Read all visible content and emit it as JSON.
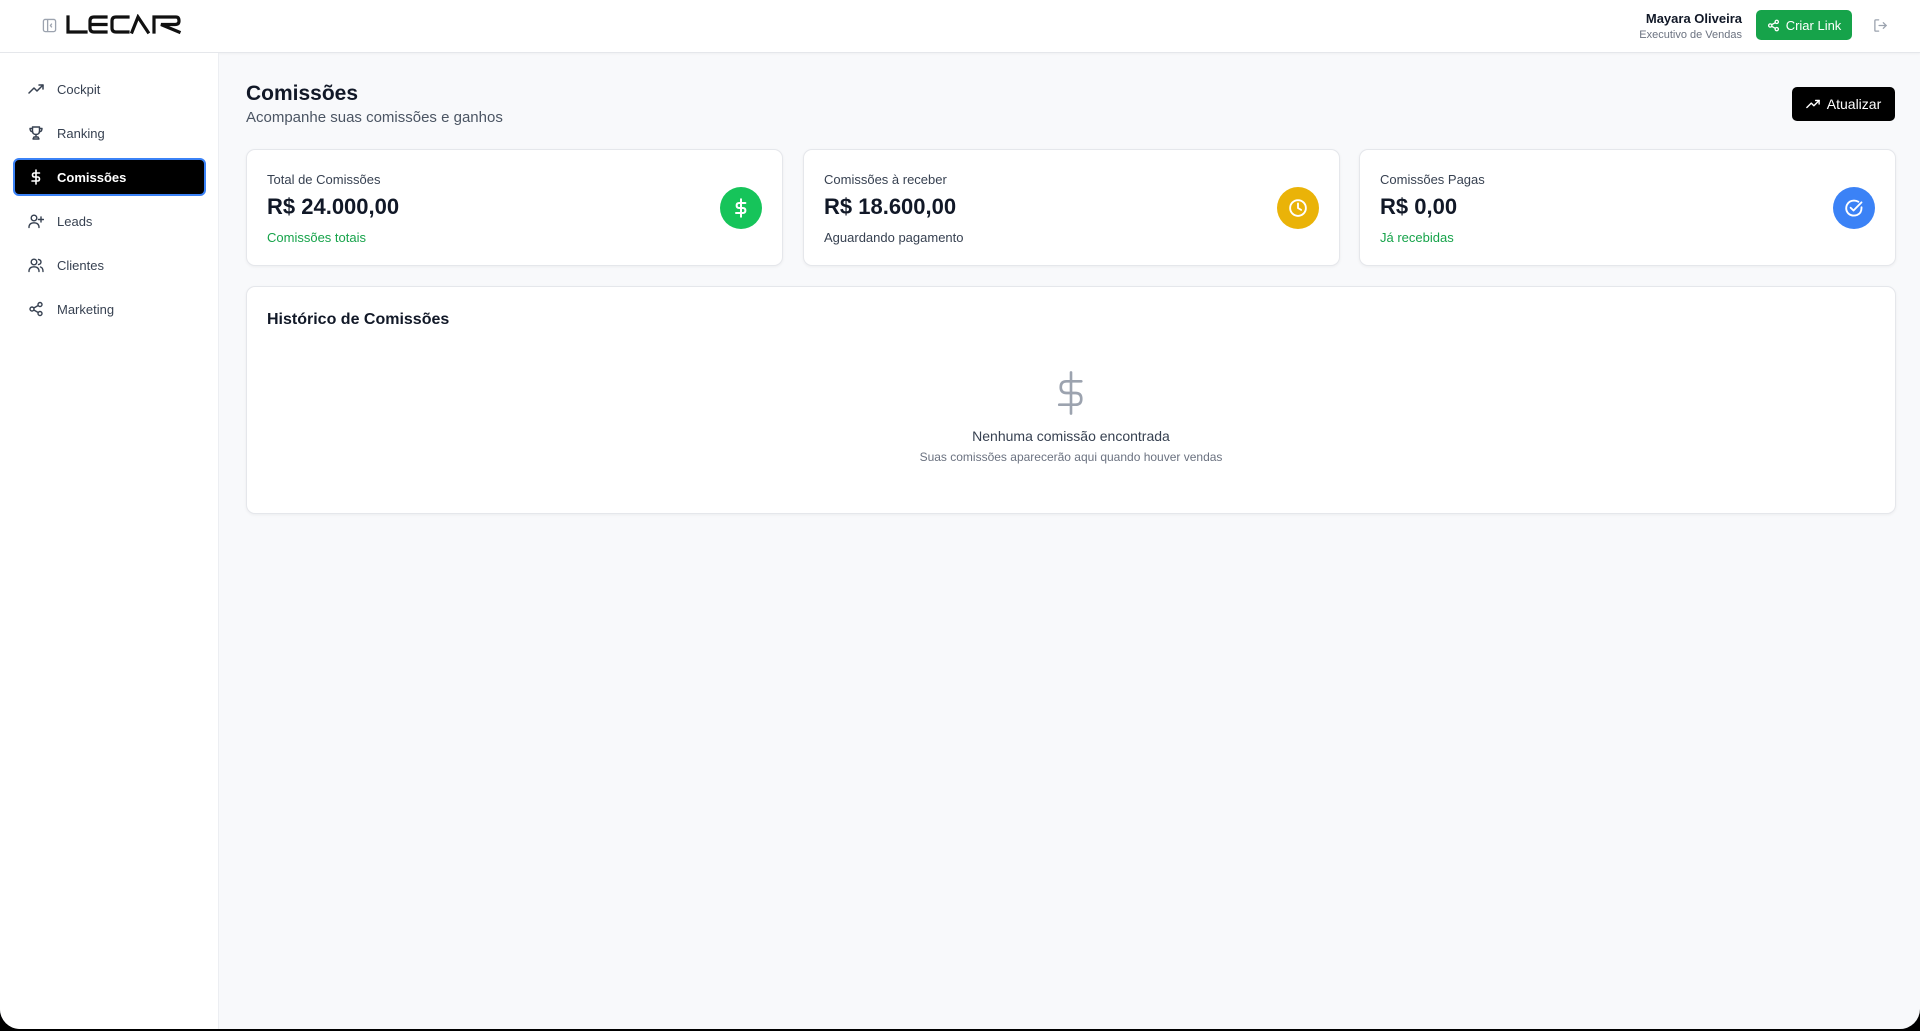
{
  "app": {
    "logo_text": "LECAR"
  },
  "header": {
    "user_name": "Mayara Oliveira",
    "user_role": "Executivo de Vendas",
    "create_link_label": "Criar Link"
  },
  "sidebar": {
    "items": [
      {
        "label": "Cockpit",
        "icon": "trending-up-icon",
        "active": false
      },
      {
        "label": "Ranking",
        "icon": "trophy-icon",
        "active": false
      },
      {
        "label": "Comissões",
        "icon": "dollar-sign-icon",
        "active": true
      },
      {
        "label": "Leads",
        "icon": "user-plus-icon",
        "active": false
      },
      {
        "label": "Clientes",
        "icon": "users-icon",
        "active": false
      },
      {
        "label": "Marketing",
        "icon": "share-icon",
        "active": false
      }
    ]
  },
  "page": {
    "title": "Comissões",
    "subtitle": "Acompanhe suas comissões e ganhos",
    "refresh_label": "Atualizar"
  },
  "stats": [
    {
      "label": "Total de Comissões",
      "value": "R$ 24.000,00",
      "sub": "Comissões totais",
      "sub_color": "#16a34a",
      "icon": "dollar-sign-icon",
      "icon_color": "#16c45a"
    },
    {
      "label": "Comissões à receber",
      "value": "R$ 18.600,00",
      "sub": "Aguardando pagamento",
      "sub_color": "#374151",
      "icon": "clock-icon",
      "icon_color": "#eab308"
    },
    {
      "label": "Comissões Pagas",
      "value": "R$ 0,00",
      "sub": "Já recebidas",
      "sub_color": "#16a34a",
      "icon": "check-circle-icon",
      "icon_color": "#3b82f6"
    }
  ],
  "history": {
    "title": "Histórico de Comissões",
    "empty_title": "Nenhuma comissão encontrada",
    "empty_sub": "Suas comissões aparecerão aqui quando houver vendas"
  },
  "colors": {
    "accent_green": "#16a34a",
    "active_outline": "#3b82f6"
  }
}
